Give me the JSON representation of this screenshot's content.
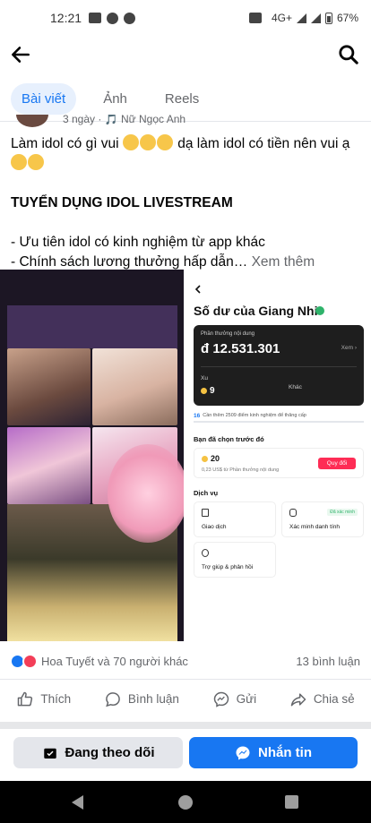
{
  "status_bar": {
    "time": "12:21",
    "network": "4G+",
    "battery": "67%"
  },
  "tabs": [
    {
      "label": "Bài viết",
      "active": true
    },
    {
      "label": "Ảnh",
      "active": false
    },
    {
      "label": "Reels",
      "active": false
    }
  ],
  "post": {
    "meta_line": "3 ngày · 🎵 Nữ Ngọc Anh",
    "line1": "Làm idol có gì vui",
    "line1_tail": "dạ làm idol có tiền nên vui ạ",
    "headline": "TUYỂN DỤNG IDOL LIVESTREAM",
    "bullet1": "- Ưu tiên idol có kinh nghiệm từ app khác",
    "bullet2": "- Chính sách lương thưởng hấp dẫn…",
    "see_more": "Xem thêm"
  },
  "wallet": {
    "title": "Số dư của Giang Nhi",
    "card_label": "Phần thưởng nội dung",
    "amount": "đ 12.531.301",
    "view_label": "Xem ›",
    "xu_label": "Xu",
    "xu_value": "9",
    "khac_label": "Khác",
    "level": "16",
    "level_note": "Cần thêm 2509 điểm kinh nghiệm để thăng cấp",
    "recent_title": "Bạn đã chọn trước đó",
    "offer_amount": "20",
    "offer_sub": "0,23 US$ từ Phần thưởng nội dung",
    "offer_button": "Quy đổi",
    "services_title": "Dịch vụ",
    "svc_transactions": "Giao dịch",
    "svc_verify": "Xác minh danh tính",
    "svc_verify_badge": "Đã xác minh",
    "svc_help": "Trợ giúp & phản hồi"
  },
  "reactions": {
    "names": "Hoa Tuyết và 70 người khác",
    "comments": "13 bình luận"
  },
  "actions": {
    "like": "Thích",
    "comment": "Bình luận",
    "send": "Gửi",
    "share": "Chia sẻ"
  },
  "bottom": {
    "following": "Đang theo dõi",
    "message": "Nhắn tin"
  }
}
